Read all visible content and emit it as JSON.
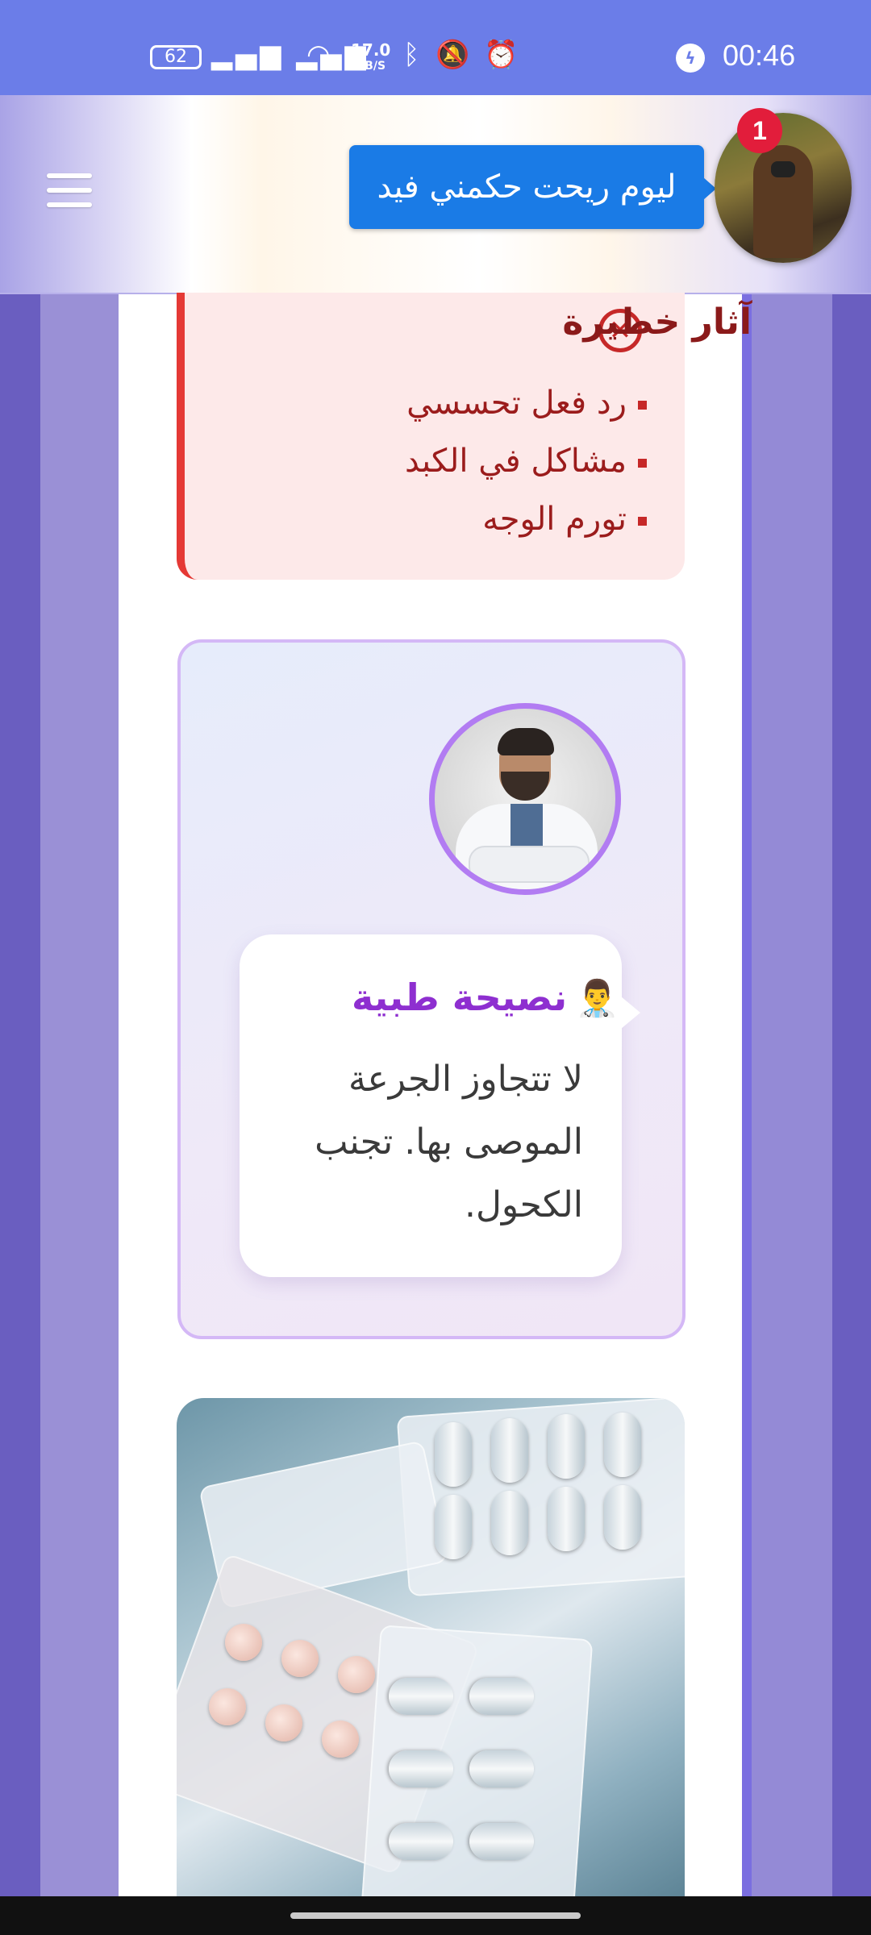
{
  "status_bar": {
    "battery": "62",
    "network_speed_value": "17.0",
    "network_speed_unit": "KB/S",
    "time": "00:46",
    "icons": [
      "signal-icon",
      "wifi-icon",
      "bluetooth-icon",
      "mute-icon",
      "alarm-icon",
      "messenger-icon"
    ]
  },
  "header": {
    "chat_bubble_text": "ليوم ريحت حكمني فيد",
    "notification_count": "1"
  },
  "danger_section": {
    "title": "آثار خطيرة",
    "items": [
      "رد فعل تحسسي",
      "مشاكل في الكبد",
      "تورم الوجه"
    ]
  },
  "tip_section": {
    "emoji": "👨‍⚕️",
    "title": "نصيحة طبية",
    "text": "لا تتجاوز الجرعة الموصى بها. تجنب الكحول."
  },
  "colors": {
    "accent": "#8e2fd0",
    "danger": "#c62828",
    "status_bar": "#6b7de8",
    "chat_bubble": "#1a7be6"
  }
}
